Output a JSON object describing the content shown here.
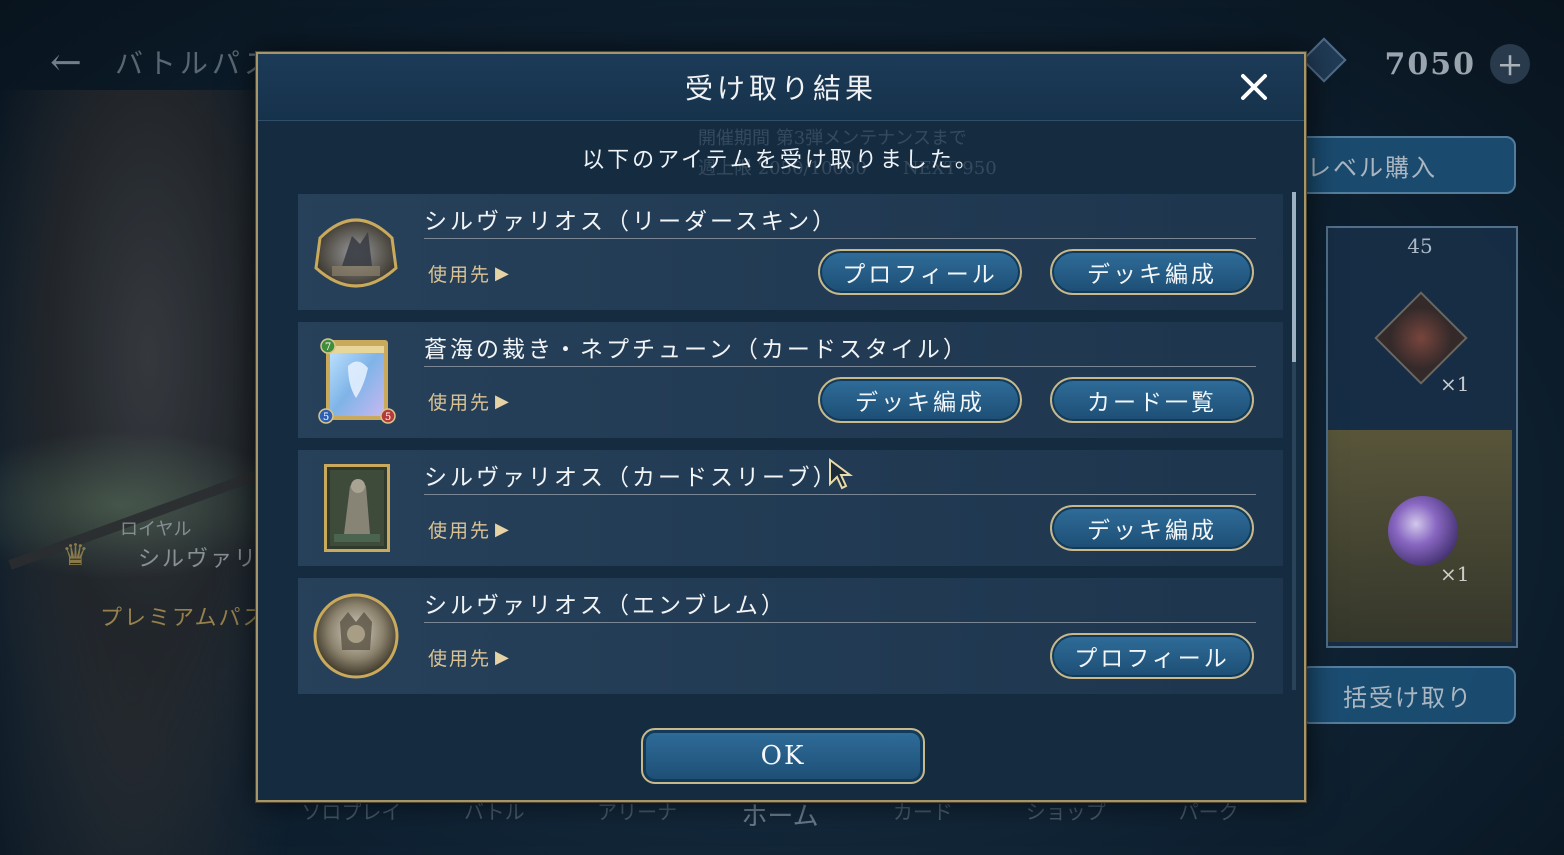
{
  "background": {
    "back_arrow": "←",
    "screen_title": "バトルパス",
    "currency_value": "7050",
    "currency_plus": "+",
    "level_purchase_button": "レベル購入",
    "ghost_period": "開催期間 第3弾メンテナンスまで",
    "ghost_weekly": "週上限 2050/10000　　NEXT 950",
    "reward_level": "45",
    "reward_count_1": "×1",
    "reward_count_2": "×1",
    "bulk_receive_button": "括受け取り",
    "class_label": "ロイヤル",
    "leader_name": "シルヴァリオス",
    "premium_label": "プレミアムパス",
    "nav": [
      "ソロプレイ",
      "バトル",
      "アリーナ",
      "ホーム",
      "カード",
      "ショップ",
      "パーク"
    ]
  },
  "dialog": {
    "title": "受け取り結果",
    "subtitle": "以下のアイテムを受け取りました。",
    "ok_label": "OK",
    "items": [
      {
        "name": "シルヴァリオス（リーダースキン）",
        "use_label": "使用先",
        "icon": "leader-skin-icon",
        "buttons": [
          "プロフィール",
          "デッキ編成"
        ]
      },
      {
        "name": "蒼海の裁き・ネプチューン（カードスタイル）",
        "use_label": "使用先",
        "icon": "card-style-icon",
        "card_cost": "7",
        "card_attack": "5",
        "card_defense": "5",
        "buttons": [
          "デッキ編成",
          "カード一覧"
        ]
      },
      {
        "name": "シルヴァリオス（カードスリーブ）",
        "use_label": "使用先",
        "icon": "card-sleeve-icon",
        "buttons": [
          "デッキ編成"
        ]
      },
      {
        "name": "シルヴァリオス（エンブレム）",
        "use_label": "使用先",
        "icon": "emblem-icon",
        "buttons": [
          "プロフィール"
        ]
      }
    ]
  },
  "colors": {
    "gold_border": "#a89567",
    "button_blue": "#2f6d9a",
    "panel_bg": "#142b40",
    "use_label": "#d9c394"
  }
}
